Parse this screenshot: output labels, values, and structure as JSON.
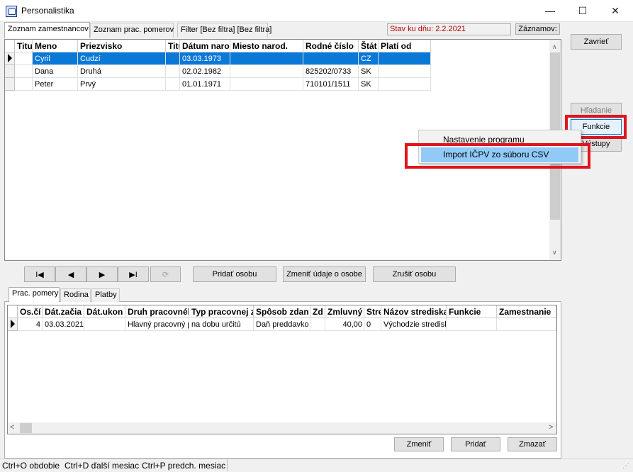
{
  "window": {
    "title": "Personalistika",
    "controls": {
      "minimize": "—",
      "maximize": "☐",
      "close": "✕"
    }
  },
  "top_tabs": [
    {
      "label": "Zoznam zamestnancov",
      "active": true
    },
    {
      "label": "Zoznam prac. pomerov",
      "active": false
    },
    {
      "label": "Filter [Bez filtra] [Bez filtra]",
      "active": false
    }
  ],
  "stav_label": "Stav ku dňu: 2.2.2021",
  "zaznamov_label": "Záznamov:",
  "employees_grid": {
    "columns": [
      "Titu",
      "Meno",
      "Priezvisko",
      "Titu",
      "Dátum narod",
      "Miesto narod.",
      "Rodné číslo",
      "Štát",
      "Platí od"
    ],
    "rows": [
      {
        "titul": "",
        "meno": "Cyril",
        "priezvisko": "Cudzí",
        "titul2": "",
        "datum": "03.03.1973",
        "miesto": "",
        "rodne": "",
        "stat": "CZ",
        "plati": "",
        "selected": true
      },
      {
        "titul": "",
        "meno": "Dana",
        "priezvisko": "Druhá",
        "titul2": "",
        "datum": "02.02.1982",
        "miesto": "",
        "rodne": "825202/0733",
        "stat": "SK",
        "plati": "",
        "selected": false
      },
      {
        "titul": "",
        "meno": "Peter",
        "priezvisko": "Prvý",
        "titul2": "",
        "datum": "01.01.1971",
        "miesto": "",
        "rodne": "710101/1511",
        "stat": "SK",
        "plati": "",
        "selected": false
      }
    ]
  },
  "nav": {
    "first": "I◀",
    "prev": "◀",
    "next": "▶",
    "last": "▶I",
    "refresh": "⟳",
    "add_person": "Pridať osobu",
    "change_person": "Zmeniť údaje o osobe",
    "cancel_person": "Zrušiť osobu"
  },
  "bottom_tabs": [
    {
      "label": "Prac. pomery",
      "active": true
    },
    {
      "label": "Rodina",
      "active": false
    },
    {
      "label": "Platby",
      "active": false
    }
  ],
  "employment_grid": {
    "columns": [
      "Os.čí",
      "Dát.začia",
      "Dát.ukon",
      "Druh pracovnél",
      "Typ pracovnej z",
      "Spôsob zdan",
      "Zd",
      "Zmluvný",
      "Stre",
      "Názov strediska",
      "Funkcie",
      "Zamestnanie"
    ],
    "rows": [
      {
        "os": "4",
        "zac": "03.03.2021",
        "ukon": "",
        "druh": "Hlavný pracovný p",
        "typ": "na dobu určitú",
        "sposob": "Daň preddavko",
        "zd": "",
        "zmluvny": "40,00",
        "stre": "0",
        "nazov": "Východzie stredisk",
        "funkcie": "",
        "zamestnanie": ""
      }
    ]
  },
  "bottom_buttons": {
    "change": "Zmeniť",
    "add": "Pridať",
    "delete": "Zmazať"
  },
  "right_buttons": {
    "close": "Zavrieť",
    "search": "Hľadanie",
    "functions": "Funkcie",
    "outputs": "Výstupy"
  },
  "context_menu": {
    "items": [
      {
        "label": "Nastavenie programu",
        "highlighted": false
      },
      {
        "label": "Import IČPV zo súboru CSV",
        "highlighted": true
      }
    ]
  },
  "status_bar": {
    "segments": [
      "Ctrl+O obdobie",
      "Ctrl+D ďalší mesiac",
      "Ctrl+P predch. mesiac"
    ]
  },
  "colors": {
    "selection": "#0a78d7",
    "highlight_box": "#e0141e",
    "menu_highlight": "#91c9f7",
    "stav_text": "#b40000"
  }
}
